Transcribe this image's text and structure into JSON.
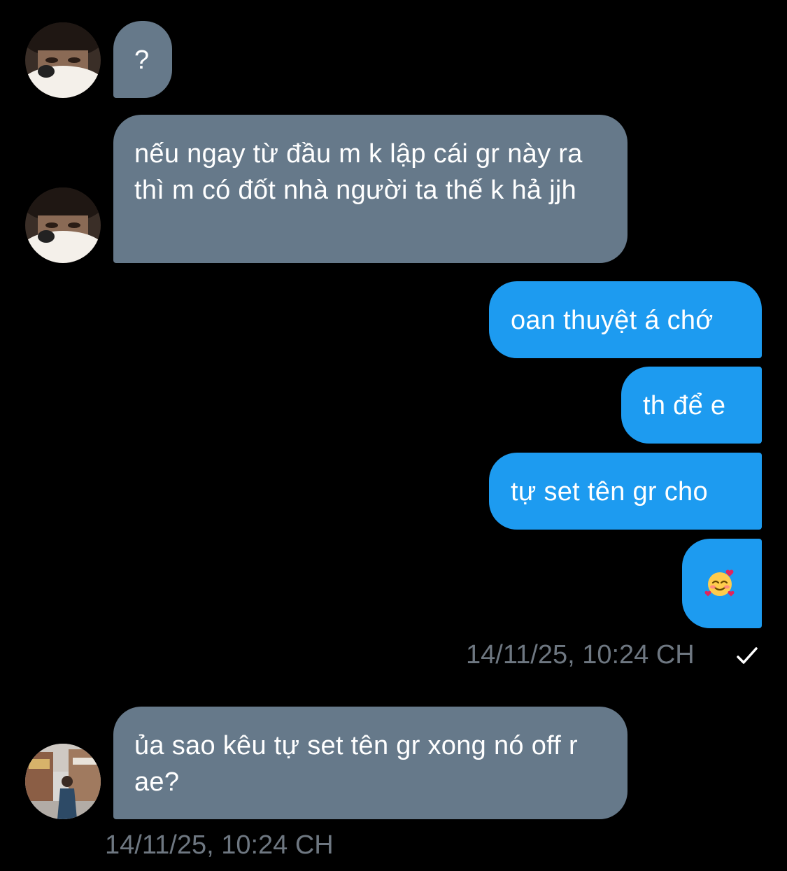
{
  "messages": [
    {
      "direction": "incoming",
      "text": "?"
    },
    {
      "direction": "incoming",
      "text": "nếu ngay từ đầu m k lập cái gr này ra thì m có đốt nhà người ta thế k hả jjh"
    },
    {
      "direction": "outgoing",
      "text": "oan thuyệt á chớ"
    },
    {
      "direction": "outgoing",
      "text": "th để e"
    },
    {
      "direction": "outgoing",
      "text": "tự set tên gr cho"
    },
    {
      "direction": "outgoing",
      "emoji": "smiling-face-with-hearts"
    },
    {
      "direction": "incoming",
      "text": "ủa sao kêu tự set tên gr xong nó off r ae?"
    }
  ],
  "sent_timestamp": "14/11/25, 10:24 CH",
  "received_timestamp": "14/11/25, 10:24 CH",
  "colors": {
    "background": "#000000",
    "incoming_bubble": "#66798a",
    "outgoing_bubble": "#1d9bf0",
    "timestamp": "#6e7781"
  }
}
